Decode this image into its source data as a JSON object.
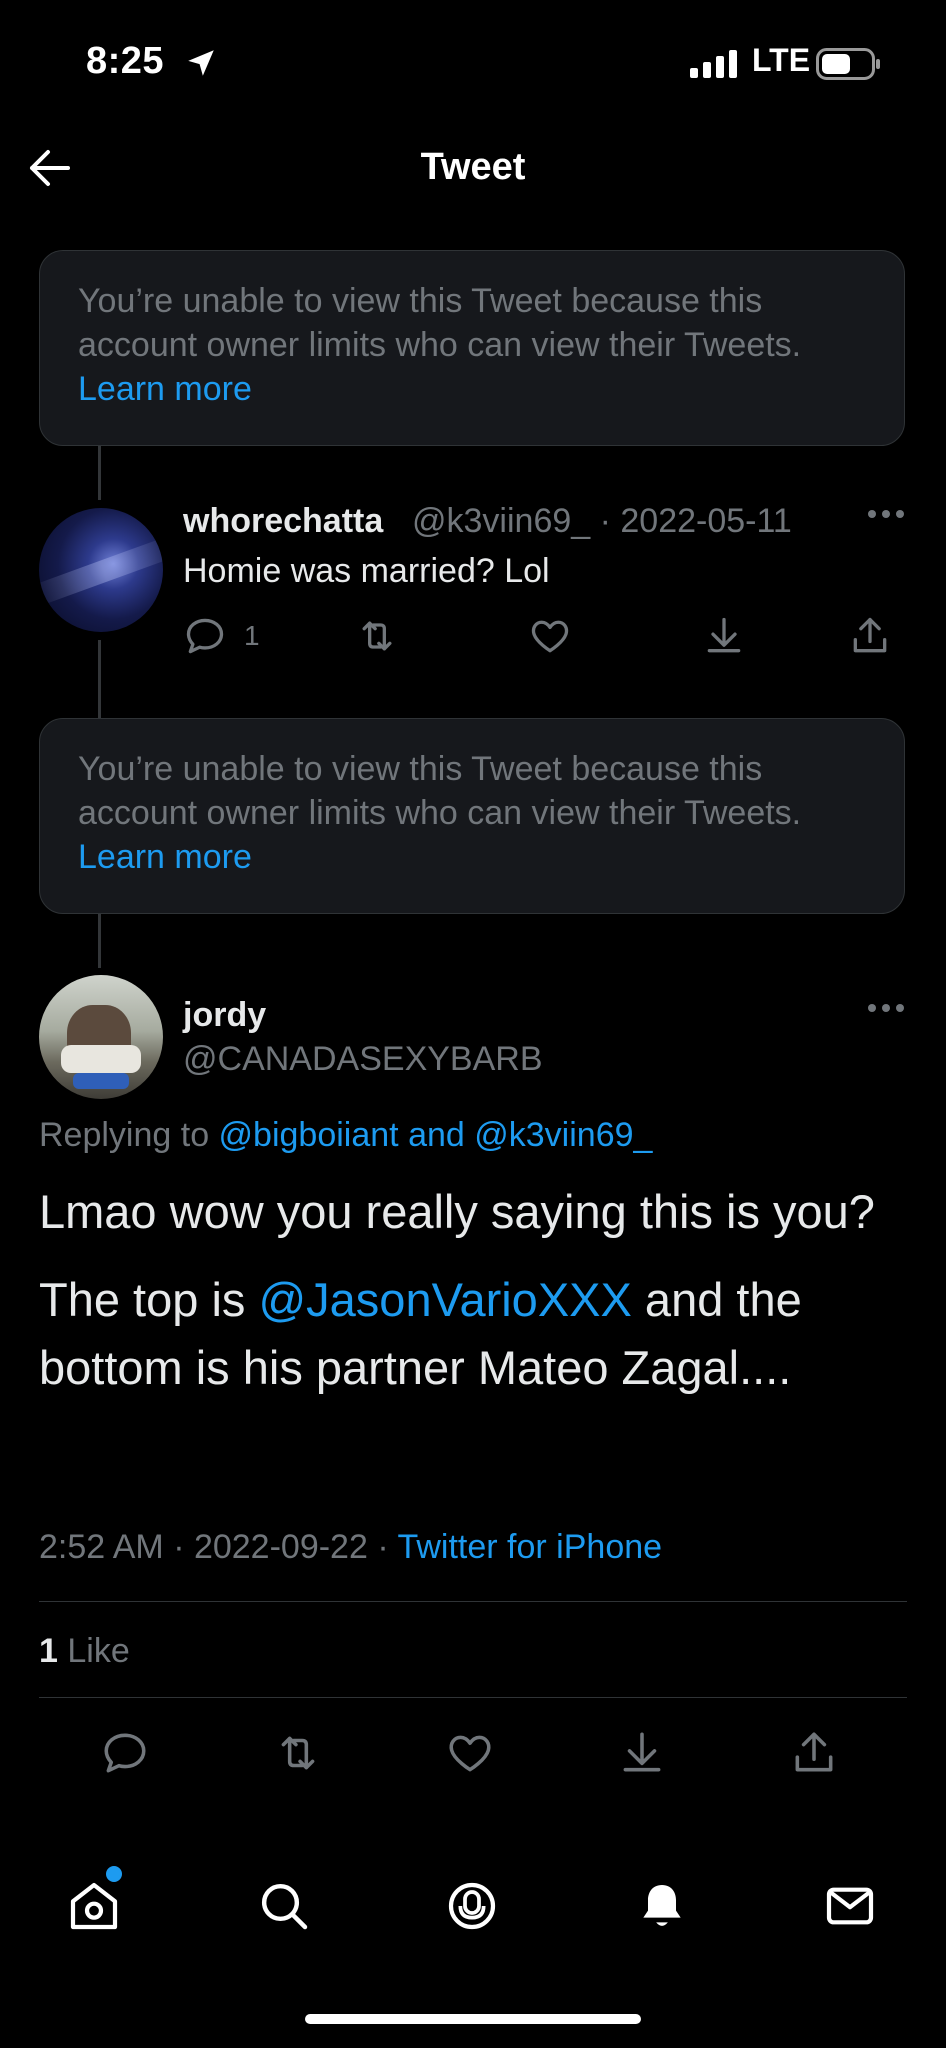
{
  "status_bar": {
    "time": "8:25",
    "network": "LTE"
  },
  "header": {
    "title": "Tweet"
  },
  "unavailable": [
    {
      "message": "You’re unable to view this Tweet because this account owner limits who can view their Tweets.",
      "link": "Learn more"
    },
    {
      "message": "You’re unable to view this Tweet because this account owner limits who can view their Tweets.",
      "link": "Learn more"
    }
  ],
  "reply_tweet": {
    "name": "whorechatta",
    "handle_date": "@k3viin69_ · 2022-05-11",
    "text": "Homie was married? Lol",
    "reply_count": "1"
  },
  "main_tweet": {
    "name": "jordy",
    "handle": "@CANADASEXYBARB",
    "replying_prefix": "Replying to ",
    "replying_to_1": "@bigboiiant",
    "replying_and": " and ",
    "replying_to_2": "@k3viin69_",
    "paragraph1": "Lmao wow you really saying this is you?",
    "paragraph2_pre": "The top is ",
    "paragraph2_mention": "@JasonVarioXXX",
    "paragraph2_post": " and the bottom is his partner  Mateo Zagal....",
    "timestamp": "2:52 AM · 2022-09-22 · ",
    "source": "Twitter for iPhone",
    "like_count": "1",
    "like_label": " Like"
  },
  "colors": {
    "accent": "#1d9bf0",
    "muted": "#71767b",
    "background": "#000000",
    "card": "#16181c"
  },
  "nav": [
    "home-icon",
    "search-icon",
    "spaces-icon",
    "notifications-icon",
    "messages-icon"
  ]
}
